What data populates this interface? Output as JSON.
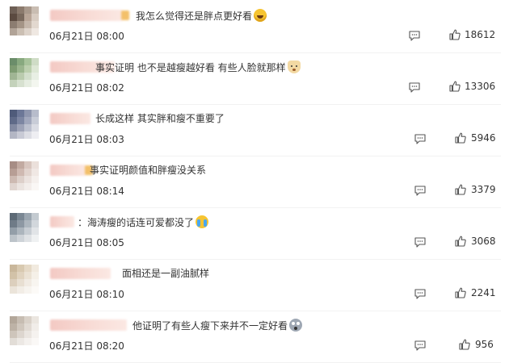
{
  "comments": [
    {
      "text": "我怎么觉得还是胖点更好看",
      "emoji": "laugh-emoji",
      "time": "06月21日 08:00",
      "likes": "18612",
      "avatar_colors": [
        "#6e5f55",
        "#8b7a6d",
        "#a9998c",
        "#c9bdb2",
        "#5b4a40",
        "#7a6a5e",
        "#b8a597",
        "#d8ccc2",
        "#8c7d71",
        "#a49486",
        "#c4b6aa",
        "#e2d8cf",
        "#b1a397",
        "#cbbfb3",
        "#ddd3ca",
        "#efe8e2"
      ]
    },
    {
      "text": "事实证明 也不是越瘦越好看 有些人脸就那样",
      "emoji": "dog-emoji",
      "time": "06月21日 08:02",
      "likes": "13306",
      "avatar_colors": [
        "#6b8d6a",
        "#88a97f",
        "#a8c39b",
        "#cfdcc6",
        "#7e9b72",
        "#9bb58e",
        "#bccfae",
        "#dde7d5",
        "#a0b594",
        "#bacbae",
        "#d2decb",
        "#e8efe4",
        "#c4d2bb",
        "#d7e1d0",
        "#e6ede1",
        "#f3f6ef"
      ]
    },
    {
      "text": "长成这样 其实胖和瘦不重要了",
      "emoji": "",
      "time": "06月21日 08:03",
      "likes": "5946",
      "avatar_colors": [
        "#4f5b7a",
        "#6c7797",
        "#8f96ae",
        "#b7bccb",
        "#5f6a88",
        "#7d86a2",
        "#a1a7bc",
        "#c8ccd7",
        "#8289a1",
        "#9ea3b7",
        "#bcc0ce",
        "#dadce4",
        "#b3b6c4",
        "#c8cad5",
        "#dcdde4",
        "#eeeef2"
      ]
    },
    {
      "text": "事实证明颜值和胖瘦没关系",
      "emoji": "",
      "time": "06月21日 08:14",
      "likes": "3379",
      "avatar_colors": [
        "#a78d85",
        "#c2aaa1",
        "#d8c6bf",
        "#ebe0db",
        "#b79e95",
        "#cfb9b1",
        "#e1d3cd",
        "#f0e8e4",
        "#cdbab2",
        "#ddd0ca",
        "#ebe2de",
        "#f5f0ed",
        "#e0d5d0",
        "#ebe4e0",
        "#f3eeeb",
        "#faf7f5"
      ]
    },
    {
      "text": "：海涛瘦的话连可爱都没了",
      "emoji": "cry-emoji",
      "time": "06月21日 08:05",
      "likes": "3068",
      "avatar_colors": [
        "#5d6a76",
        "#7a8793",
        "#9ba6b0",
        "#c3cad0",
        "#6f7b87",
        "#8d98a3",
        "#adb6be",
        "#d2d7dc",
        "#939ea8",
        "#acb5bd",
        "#c7cdd3",
        "#e1e4e7",
        "#bcc3c9",
        "#ced3d8",
        "#dfe2e5",
        "#eff1f2"
      ]
    },
    {
      "text": "面相还是一副油腻样",
      "emoji": "",
      "time": "06月21日 08:10",
      "likes": "2241",
      "avatar_colors": [
        "#c9b79b",
        "#d8c9b0",
        "#e5d9c6",
        "#f1eadf",
        "#d2c2a8",
        "#e0d3bf",
        "#ebe2d4",
        "#f5f0e8",
        "#dccfbd",
        "#e8dfd2",
        "#f1ebe3",
        "#f8f5f0",
        "#ebe4da",
        "#f2ede6",
        "#f7f4ef",
        "#fcfaf7"
      ]
    },
    {
      "text": "他证明了有些人瘦下来并不一定好看",
      "emoji": "shock-emoji",
      "time": "06月21日 08:20",
      "likes": "956",
      "avatar_colors": [
        "#b3a79a",
        "#c7bdb2",
        "#d9d1c8",
        "#ebe6e0",
        "#bdb2a6",
        "#d0c7bd",
        "#e1dad3",
        "#f1ede9",
        "#cec5bb",
        "#ddd6cf",
        "#eae5e0",
        "#f5f2ef",
        "#e2ddd7",
        "#ece8e4",
        "#f4f1ee",
        "#faf8f6"
      ]
    }
  ]
}
